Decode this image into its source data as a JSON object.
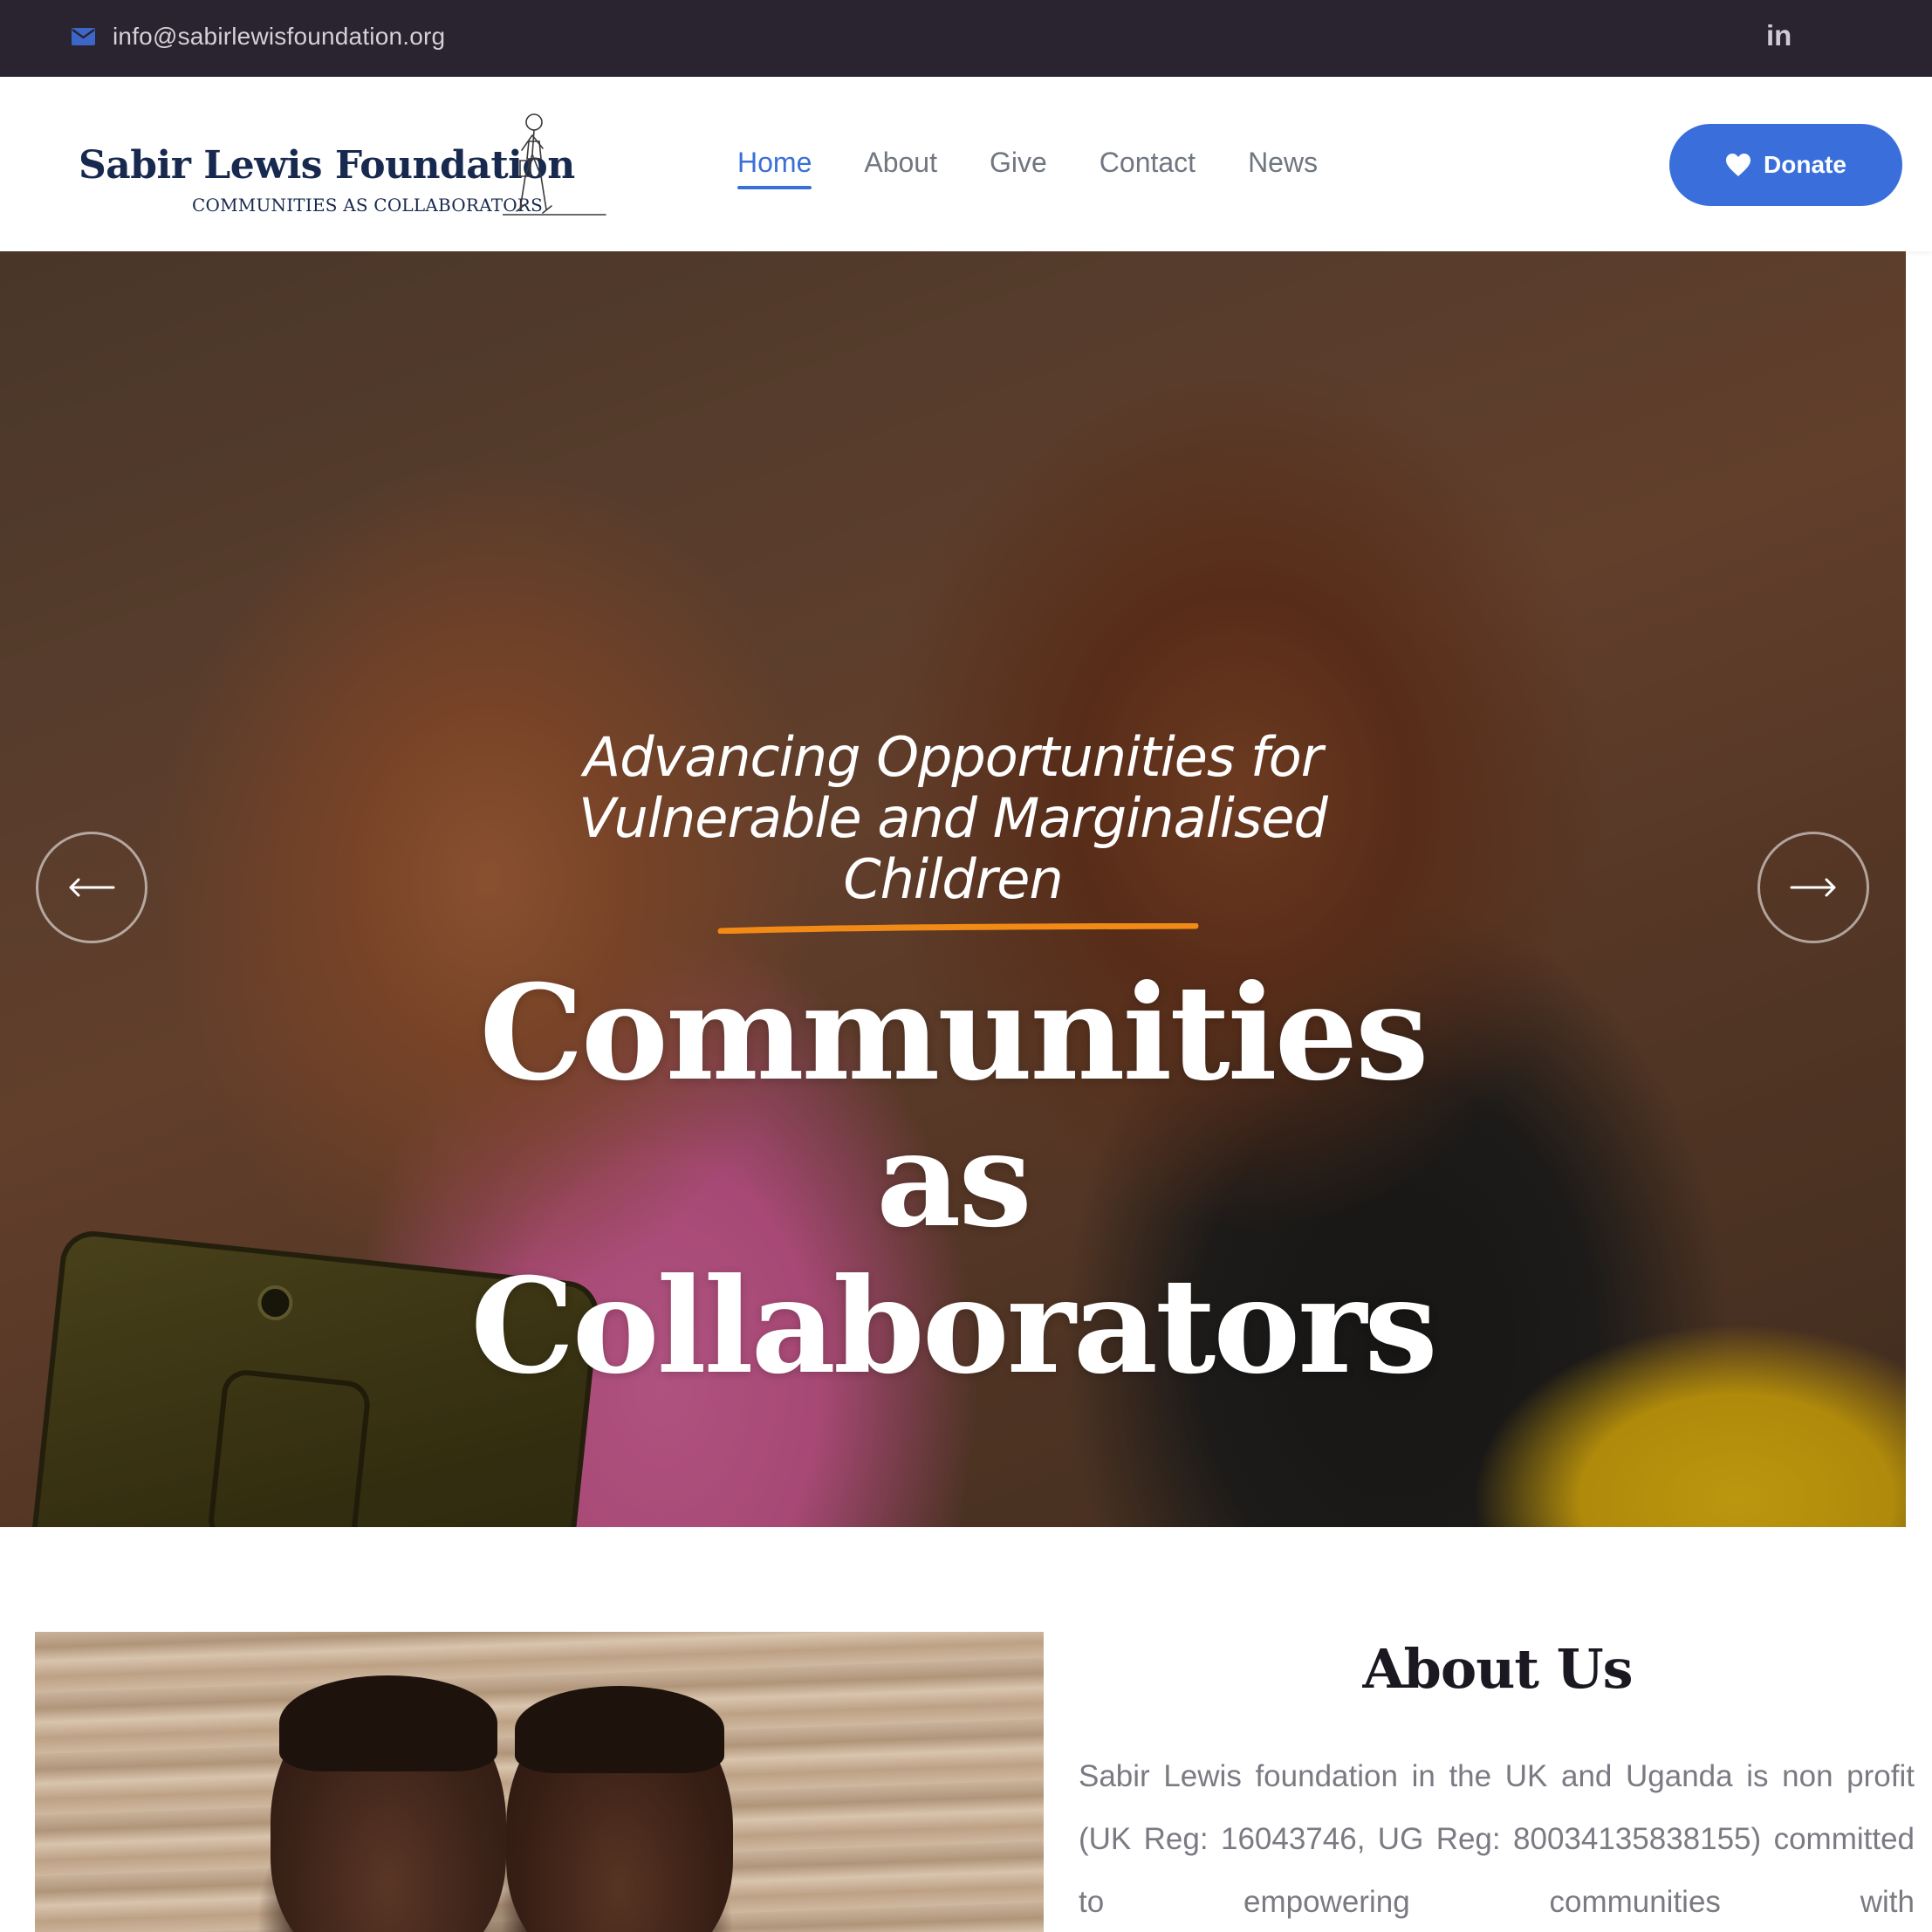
{
  "topbar": {
    "email": "info@sabirlewisfoundation.org",
    "email_icon": "envelope-icon",
    "social_icon": "linkedin-icon",
    "social_label": "in"
  },
  "header": {
    "logo": {
      "name": "Sabir Lewis Foundation",
      "tagline": "COMMUNITIES AS COLLABORATORS",
      "illustration_icon": "children-sketch-icon"
    },
    "nav": [
      {
        "label": "Home",
        "active": true
      },
      {
        "label": "About",
        "active": false
      },
      {
        "label": "Give",
        "active": false
      },
      {
        "label": "Contact",
        "active": false
      },
      {
        "label": "News",
        "active": false
      }
    ],
    "donate": {
      "label": "Donate",
      "icon": "heart-icon"
    }
  },
  "hero": {
    "tagline_lines": [
      "Advancing Opportunities for",
      "Vulnerable and Marginalised",
      "Children"
    ],
    "headline_lines": [
      "Communities",
      "as",
      "Collaborators"
    ],
    "prev_icon": "arrow-left-icon",
    "next_icon": "arrow-right-icon",
    "accent_color": "#f28a16"
  },
  "about": {
    "title": "About Us",
    "text": "Sabir Lewis foundation in the UK and Uganda is non profit (UK Reg: 16043746, UG Reg: 80034135838155) committed to empowering communities with"
  },
  "colors": {
    "topbar_bg": "#29242f",
    "brand_navy": "#17294e",
    "primary_blue": "#3a6fdb",
    "nav_text": "#707781"
  }
}
